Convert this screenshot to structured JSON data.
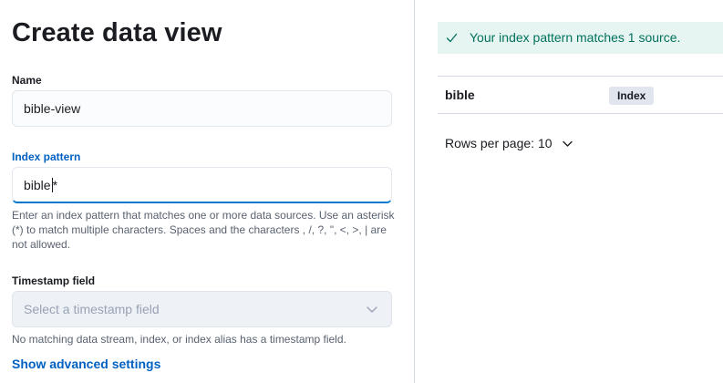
{
  "form": {
    "title": "Create data view",
    "name_label": "Name",
    "name_value": "bible-view",
    "index_label": "Index pattern",
    "index_value": "bible",
    "index_value_suffix": "*",
    "index_help": "Enter an index pattern that matches one or more data sources. Use an asterisk (*) to match multiple characters. Spaces and the characters , /, ?, \", <, >, | are not allowed.",
    "timestamp_label": "Timestamp field",
    "timestamp_placeholder": "Select a timestamp field",
    "timestamp_help": "No matching data stream, index, or index alias has a timestamp field.",
    "advanced_link": "Show advanced settings"
  },
  "preview": {
    "callout": "Your index pattern matches 1 source.",
    "rows": [
      {
        "name": "bible",
        "type": "Index"
      }
    ],
    "rows_per_page": "Rows per page: 10"
  },
  "colors": {
    "accent": "#0077cc",
    "success_bg": "#e6f5f1",
    "success_text": "#00715c"
  },
  "icons": {
    "callout": "check-icon",
    "timestamp_select": "chevron-down-icon",
    "rows_per_page": "chevron-down-icon"
  }
}
